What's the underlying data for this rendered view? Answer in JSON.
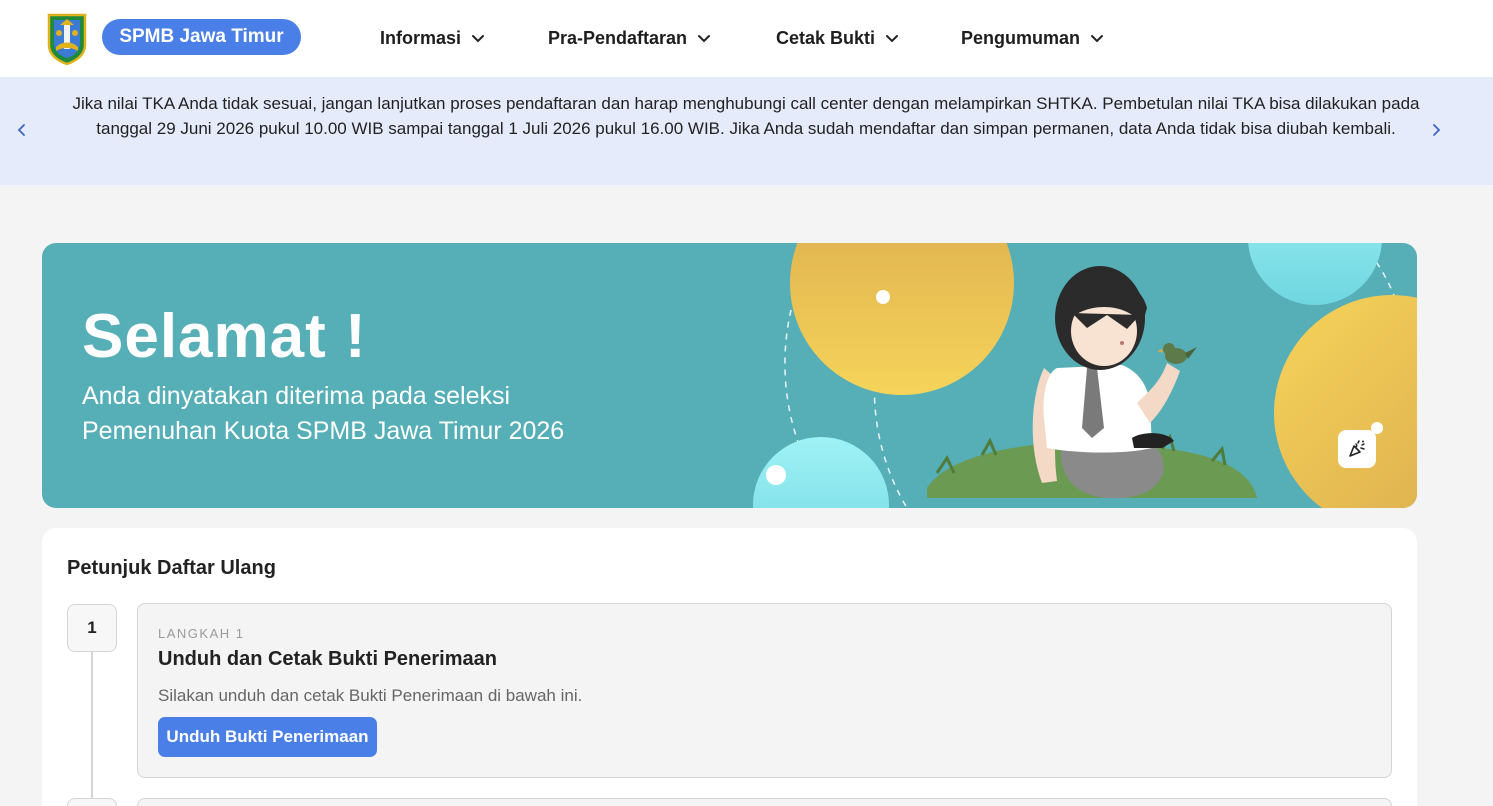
{
  "header": {
    "brand": "SPMB Jawa Timur",
    "nav": [
      {
        "label": "Informasi"
      },
      {
        "label": "Pra-Pendaftaran"
      },
      {
        "label": "Cetak Bukti"
      },
      {
        "label": "Pengumuman"
      }
    ]
  },
  "announcement": {
    "text": "Jika nilai TKA Anda tidak sesuai, jangan lanjutkan proses pendaftaran dan harap menghubungi call center dengan melampirkan SHTKA. Pembetulan nilai TKA bisa dilakukan pada tanggal 29 Juni 2026 pukul 10.00 WIB sampai tanggal 1 Juli 2026 pukul 16.00 WIB. Jika Anda sudah mendaftar dan simpan permanen, data Anda tidak bisa diubah kembali."
  },
  "hero": {
    "title": "Selamat !",
    "subtitle": "Anda dinyatakan diterima pada seleksi Pemenuhan Kuota SPMB Jawa Timur 2026"
  },
  "instructions": {
    "title": "Petunjuk Daftar Ulang",
    "steps": [
      {
        "number": "1",
        "label": "LANGKAH 1",
        "heading": "Unduh dan Cetak Bukti Penerimaan",
        "description": "Silakan unduh dan cetak Bukti Penerimaan di bawah ini.",
        "button": "Unduh Bukti Penerimaan"
      }
    ]
  },
  "colors": {
    "accent": "#4a7fe8",
    "hero_bg": "#56aeb6",
    "announce_bg": "#e6ebfb"
  },
  "icons": {
    "logo": "east-java-emblem",
    "nav_chevron": "chevron-down-icon",
    "carousel_prev": "chevron-left-icon",
    "carousel_next": "chevron-right-icon",
    "confetti": "party-popper-icon"
  }
}
